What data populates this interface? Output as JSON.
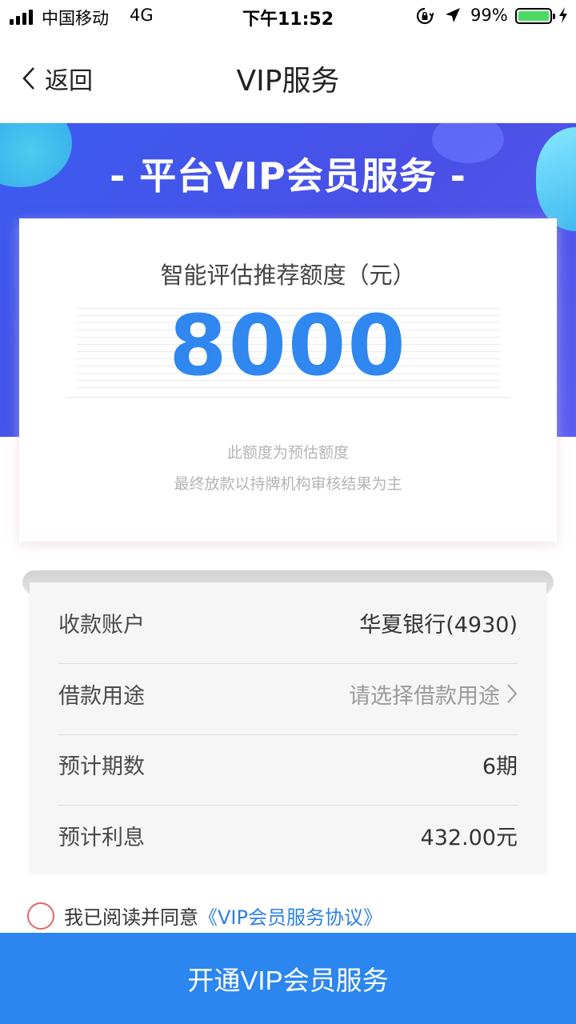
{
  "status_bar": {
    "carrier": "中国移动",
    "network": "4G",
    "time": "下午11:52",
    "battery_percent": "99%",
    "battery_level": 0.99,
    "icons": [
      "signal-icon",
      "orientation-lock-icon",
      "location-arrow-icon",
      "battery-icon",
      "charging-bolt-icon"
    ]
  },
  "nav": {
    "back_label": "返回",
    "title": "VIP服务"
  },
  "banner": {
    "title": "- 平台VIP会员服务 -"
  },
  "quota": {
    "label": "智能评估推荐额度（元）",
    "value": "8000",
    "note_line1": "此额度为预估额度",
    "note_line2": "最终放款以持牌机构审核结果为主"
  },
  "info": {
    "rows": [
      {
        "label": "收款账户",
        "value": "华夏银行(4930)"
      },
      {
        "label": "借款用途",
        "value": "请选择借款用途"
      },
      {
        "label": "预计期数",
        "value": "6期"
      },
      {
        "label": "预计利息",
        "value": "432.00元"
      }
    ]
  },
  "agreement": {
    "text": "我已阅读并同意",
    "link": "《VIP会员服务协议》",
    "checked": false
  },
  "action": {
    "button_label": "开通VIP会员服务"
  },
  "colors": {
    "accent": "#2c86ef",
    "banner": "#4a4fe6",
    "radio_border": "#e8655e"
  }
}
